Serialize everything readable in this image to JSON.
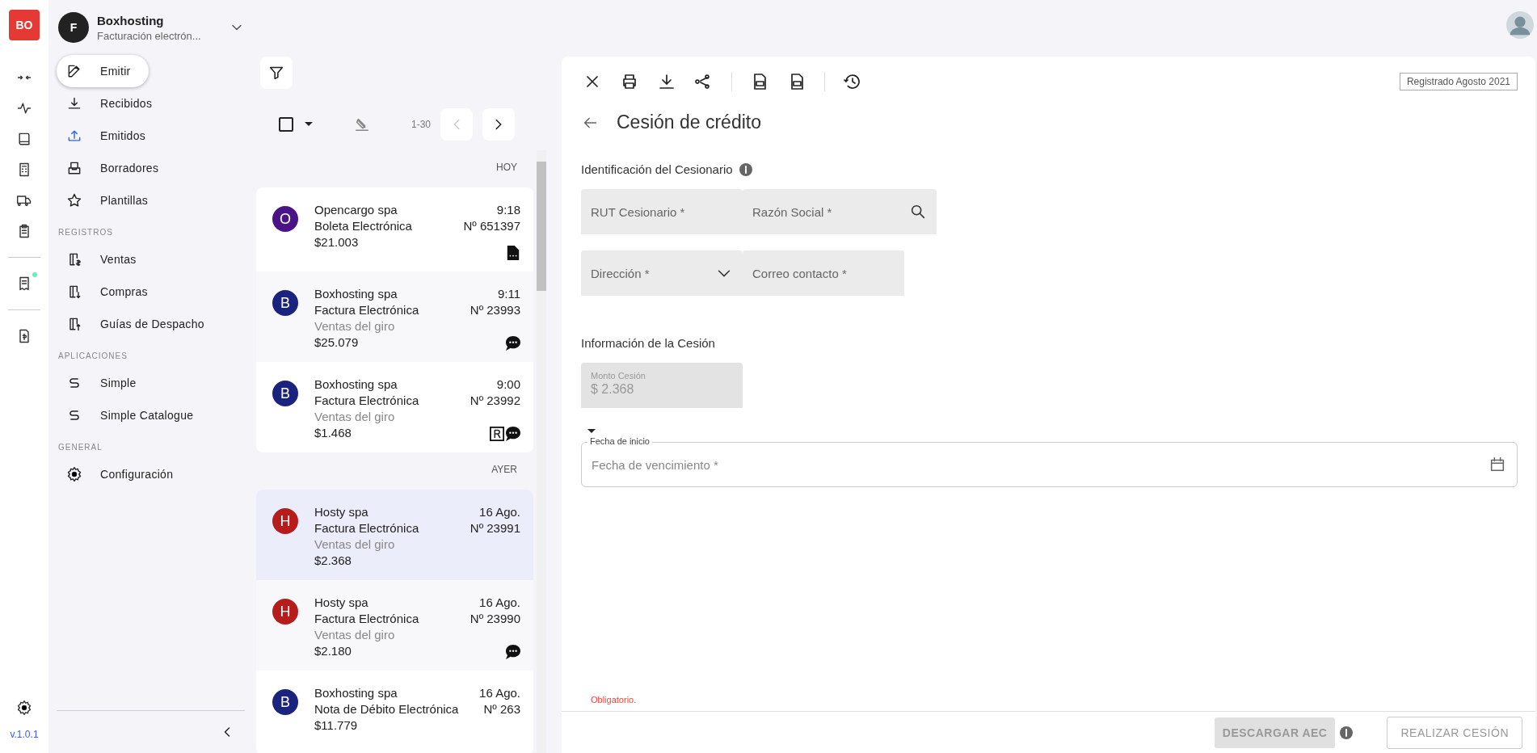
{
  "rail": {
    "logo": "BO",
    "items": [
      {
        "kind": "arrows",
        "notification": false
      },
      {
        "kind": "pulse",
        "notification": false
      },
      {
        "kind": "book",
        "notification": false
      },
      {
        "kind": "calculator",
        "notification": false
      },
      {
        "kind": "truck",
        "notification": false
      },
      {
        "kind": "clipboard",
        "notification": false
      },
      {
        "kind": "divider"
      },
      {
        "kind": "receipt",
        "notification": true
      },
      {
        "kind": "divider"
      },
      {
        "kind": "money",
        "notification": false
      }
    ],
    "version": "v.1.0.1"
  },
  "company": {
    "initial": "F",
    "name": "Boxhosting",
    "subtitle": "Facturación electrón..."
  },
  "sidebar": {
    "groups": [
      {
        "items": [
          {
            "label": "Emitir",
            "kind": "action",
            "selected": false
          },
          {
            "label": "Recibidos",
            "kind": "link",
            "selected": false
          },
          {
            "label": "Emitidos",
            "kind": "link",
            "selected": true
          },
          {
            "label": "Borradores",
            "kind": "link",
            "selected": false
          },
          {
            "label": "Plantillas",
            "kind": "link",
            "selected": false
          }
        ]
      },
      {
        "title": "REGISTROS",
        "items": [
          {
            "label": "Ventas",
            "kind": "link",
            "selected": false
          },
          {
            "label": "Compras",
            "kind": "link",
            "selected": false
          },
          {
            "label": "Guías de Despacho",
            "kind": "link",
            "selected": false
          }
        ]
      },
      {
        "title": "APLICACIONES",
        "items": [
          {
            "label": "Simple",
            "kind": "link",
            "selected": false
          },
          {
            "label": "Simple Catalogue",
            "kind": "link",
            "selected": false
          }
        ]
      },
      {
        "title": "GENERAL",
        "items": [
          {
            "label": "Configuración",
            "kind": "link",
            "selected": false
          }
        ]
      }
    ]
  },
  "list": {
    "select_all": {
      "checked": false
    },
    "range": "1-30",
    "groups": [
      {
        "label": "HOY",
        "rows": [
          {
            "initial": "O",
            "color": "#4a1486",
            "name": "Opencargo spa",
            "type": "Boleta Electrónica",
            "amount": "$21.003",
            "time": "9:18",
            "number": "Nº 651397",
            "marks": [
              {
                "kind": "document"
              }
            ],
            "selected": false
          },
          {
            "initial": "B",
            "color": "#1a237e",
            "name": "Boxhosting spa",
            "type": "Factura Electrónica",
            "detail": "Ventas del giro",
            "amount": "$25.079",
            "time": "9:11",
            "number": "Nº 23993",
            "marks": [
              {
                "kind": "comment"
              }
            ],
            "selected": false
          },
          {
            "initial": "B",
            "color": "#1a237e",
            "name": "Boxhosting spa",
            "type": "Factura Electrónica",
            "detail": "Ventas del giro",
            "amount": "$1.468",
            "time": "9:00",
            "number": "Nº 23992",
            "marks": [
              {
                "kind": "r"
              },
              {
                "kind": "comment"
              }
            ],
            "selected": false
          }
        ]
      },
      {
        "label": "AYER",
        "rows": [
          {
            "initial": "H",
            "color": "#b71c1c",
            "name": "Hosty spa",
            "type": "Factura Electrónica",
            "detail": "Ventas del giro",
            "amount": "$2.368",
            "time": "16 Ago.",
            "number": "Nº 23991",
            "selected": true
          },
          {
            "initial": "H",
            "color": "#b71c1c",
            "name": "Hosty spa",
            "type": "Factura Electrónica",
            "detail": "Ventas del giro",
            "amount": "$2.180",
            "time": "16 Ago.",
            "number": "Nº 23990",
            "marks": [
              {
                "kind": "comment"
              }
            ],
            "selected": false
          },
          {
            "initial": "B",
            "color": "#1a237e",
            "name": "Boxhosting spa",
            "type": "Nota de Débito Electrónica",
            "amount": "$11.779",
            "time": "16 Ago.",
            "number": "Nº 263",
            "selected": false
          }
        ]
      }
    ]
  },
  "detail": {
    "toolbar": [
      {
        "kind": "close"
      },
      {
        "kind": "print"
      },
      {
        "kind": "download"
      },
      {
        "kind": "share"
      },
      {
        "kind": "separator"
      },
      {
        "kind": "xml"
      },
      {
        "kind": "ced"
      },
      {
        "kind": "separator"
      },
      {
        "kind": "history"
      }
    ],
    "registered": "Registrado Agosto 2021",
    "title": "Cesión de crédito",
    "section1": "Identificación del Cesionario",
    "fields1": [
      {
        "placeholder": "RUT Cesionario *",
        "kind": "text"
      },
      {
        "placeholder": "Razón Social *",
        "kind": "search"
      }
    ],
    "fields2": [
      {
        "placeholder": "Dirección *",
        "kind": "select"
      },
      {
        "placeholder": "Correo contacto *",
        "kind": "text"
      }
    ],
    "section2": "Información de la Cesión",
    "amount_field": {
      "label": "Monto Cesión",
      "value": "$ 2.368",
      "disabled": true
    },
    "date_field": {
      "label": "Fecha de inicio",
      "placeholder": "Fecha de vencimiento *"
    },
    "error": "Obligatorio.",
    "buttons": [
      {
        "label": "DESCARGAR AEC",
        "kind": "filled",
        "disabled": true
      },
      {
        "label": "REALIZAR CESIÓN",
        "kind": "outlined",
        "disabled": true
      }
    ]
  }
}
